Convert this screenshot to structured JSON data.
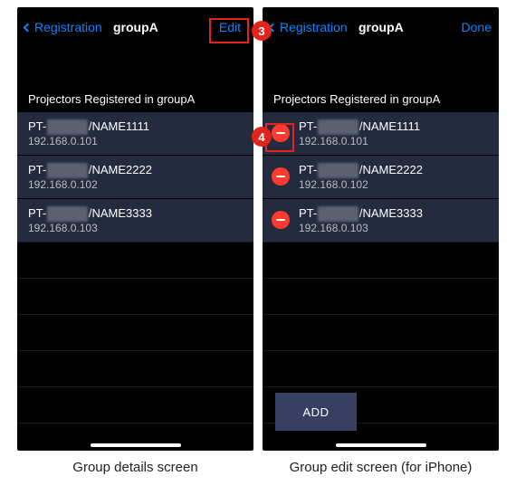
{
  "annotations": {
    "a3": "3",
    "a4": "4"
  },
  "left": {
    "back_label": "Registration",
    "title": "groupA",
    "right_label": "Edit",
    "section_header": "Projectors Registered in groupA",
    "rows": [
      {
        "name_prefix": "PT-",
        "name_hidden": "RQ25K",
        "name_suffix": "/NAME1111",
        "ip": "192.168.0.101"
      },
      {
        "name_prefix": "PT-",
        "name_hidden": "RQ25K",
        "name_suffix": "/NAME2222",
        "ip": "192.168.0.102"
      },
      {
        "name_prefix": "PT-",
        "name_hidden": "RQ25K",
        "name_suffix": "/NAME3333",
        "ip": "192.168.0.103"
      }
    ],
    "caption": "Group details screen"
  },
  "right": {
    "back_label": "Registration",
    "title": "groupA",
    "right_label": "Done",
    "section_header": "Projectors Registered in groupA",
    "rows": [
      {
        "name_prefix": "PT-",
        "name_hidden": "RQ25K",
        "name_suffix": "/NAME1111",
        "ip": "192.168.0.101"
      },
      {
        "name_prefix": "PT-",
        "name_hidden": "RQ25K",
        "name_suffix": "/NAME2222",
        "ip": "192.168.0.102"
      },
      {
        "name_prefix": "PT-",
        "name_hidden": "RQ25K",
        "name_suffix": "/NAME3333",
        "ip": "192.168.0.103"
      }
    ],
    "add_label": "ADD",
    "caption": "Group edit screen (for iPhone)"
  }
}
